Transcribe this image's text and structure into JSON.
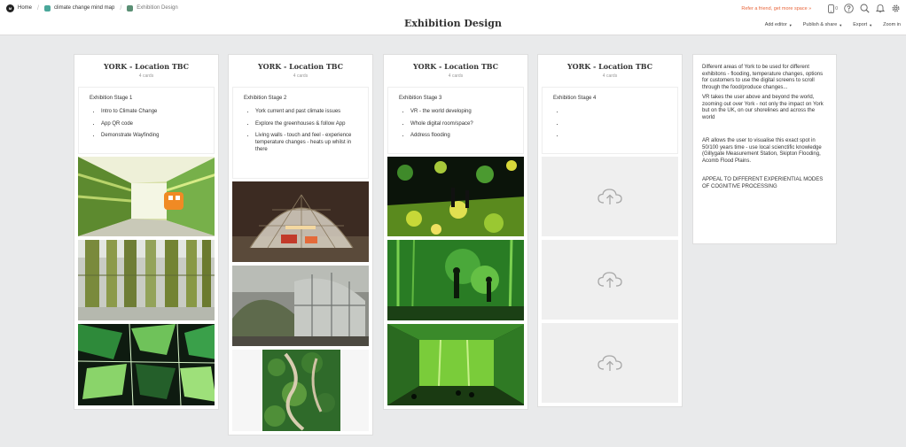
{
  "breadcrumb": {
    "logo": "M",
    "home": "Home",
    "mind_map": "climate change mind map",
    "current": "Exhibition Design",
    "mind_map_color": "#4aa79a",
    "current_color": "#5a8f74"
  },
  "board_title": "Exhibition Design",
  "top_right": {
    "refer_link": "Refer a friend, get more space »",
    "device_count": "0",
    "icons": [
      "device-icon",
      "help-icon",
      "search-icon",
      "bell-icon",
      "gear-icon"
    ]
  },
  "menus": [
    {
      "label": "Add editor",
      "has_caret": true
    },
    {
      "label": "Publish & share",
      "has_caret": true
    },
    {
      "label": "Export",
      "has_caret": true
    },
    {
      "label": "Zoom in",
      "has_caret": false
    }
  ],
  "columns": [
    {
      "title": "YORK - Location TBC",
      "count": "4 cards",
      "note_title": "Exhibition Stage 1",
      "bullets": [
        "Intro to Climate Change",
        "App QR code",
        "Demonstrate Wayfinding"
      ],
      "images": [
        "exhibit-corridor",
        "bamboo-installation",
        "green-light-gallery"
      ]
    },
    {
      "title": "YORK - Location TBC",
      "count": "4 cards",
      "note_title": "Exhibition Stage 2",
      "bullets": [
        "York current and past climate issues",
        "Explore the greenhouses & follow App",
        "Living walls - touch and feel - experience temperature changes - heats up whilst in there"
      ],
      "images": [
        "geodesic-dome",
        "greenhouse-pods",
        "living-wall"
      ]
    },
    {
      "title": "YORK - Location TBC",
      "count": "4 cards",
      "note_title": "Exhibition Stage 3",
      "bullets": [
        "VR - the world developing",
        "Whole digital room/space?",
        "Address flooding"
      ],
      "images": [
        "digital-flower-room",
        "immersive-projection",
        "green-screen-room"
      ]
    },
    {
      "title": "YORK - Location TBC",
      "count": "4 cards",
      "note_title": "Exhibition Stage 4",
      "bullets": [
        "",
        "",
        ""
      ],
      "images": []
    }
  ],
  "side_note": {
    "p1": "Different areas of York to be used for different exhibitons - flooding, temperature changes, options for customers to use the digital screens to scroll through the food/produce changes...",
    "p2": "VR takes the user above and beyond the world, zooming out over York - not only the impact on York but on the UK, on our shorelines and across the world",
    "p3": "AR allows the user to visualise this exact spot in 50/100 years time - use local scienctific knowledge  (Gillygate Measurement Station, Skipton Flooding, Acomb Flood Plains.",
    "p4": "APPEAL TO DIFFERENT EXPERIENTIAL MODES OF COGNITIVE PROCESSING"
  }
}
